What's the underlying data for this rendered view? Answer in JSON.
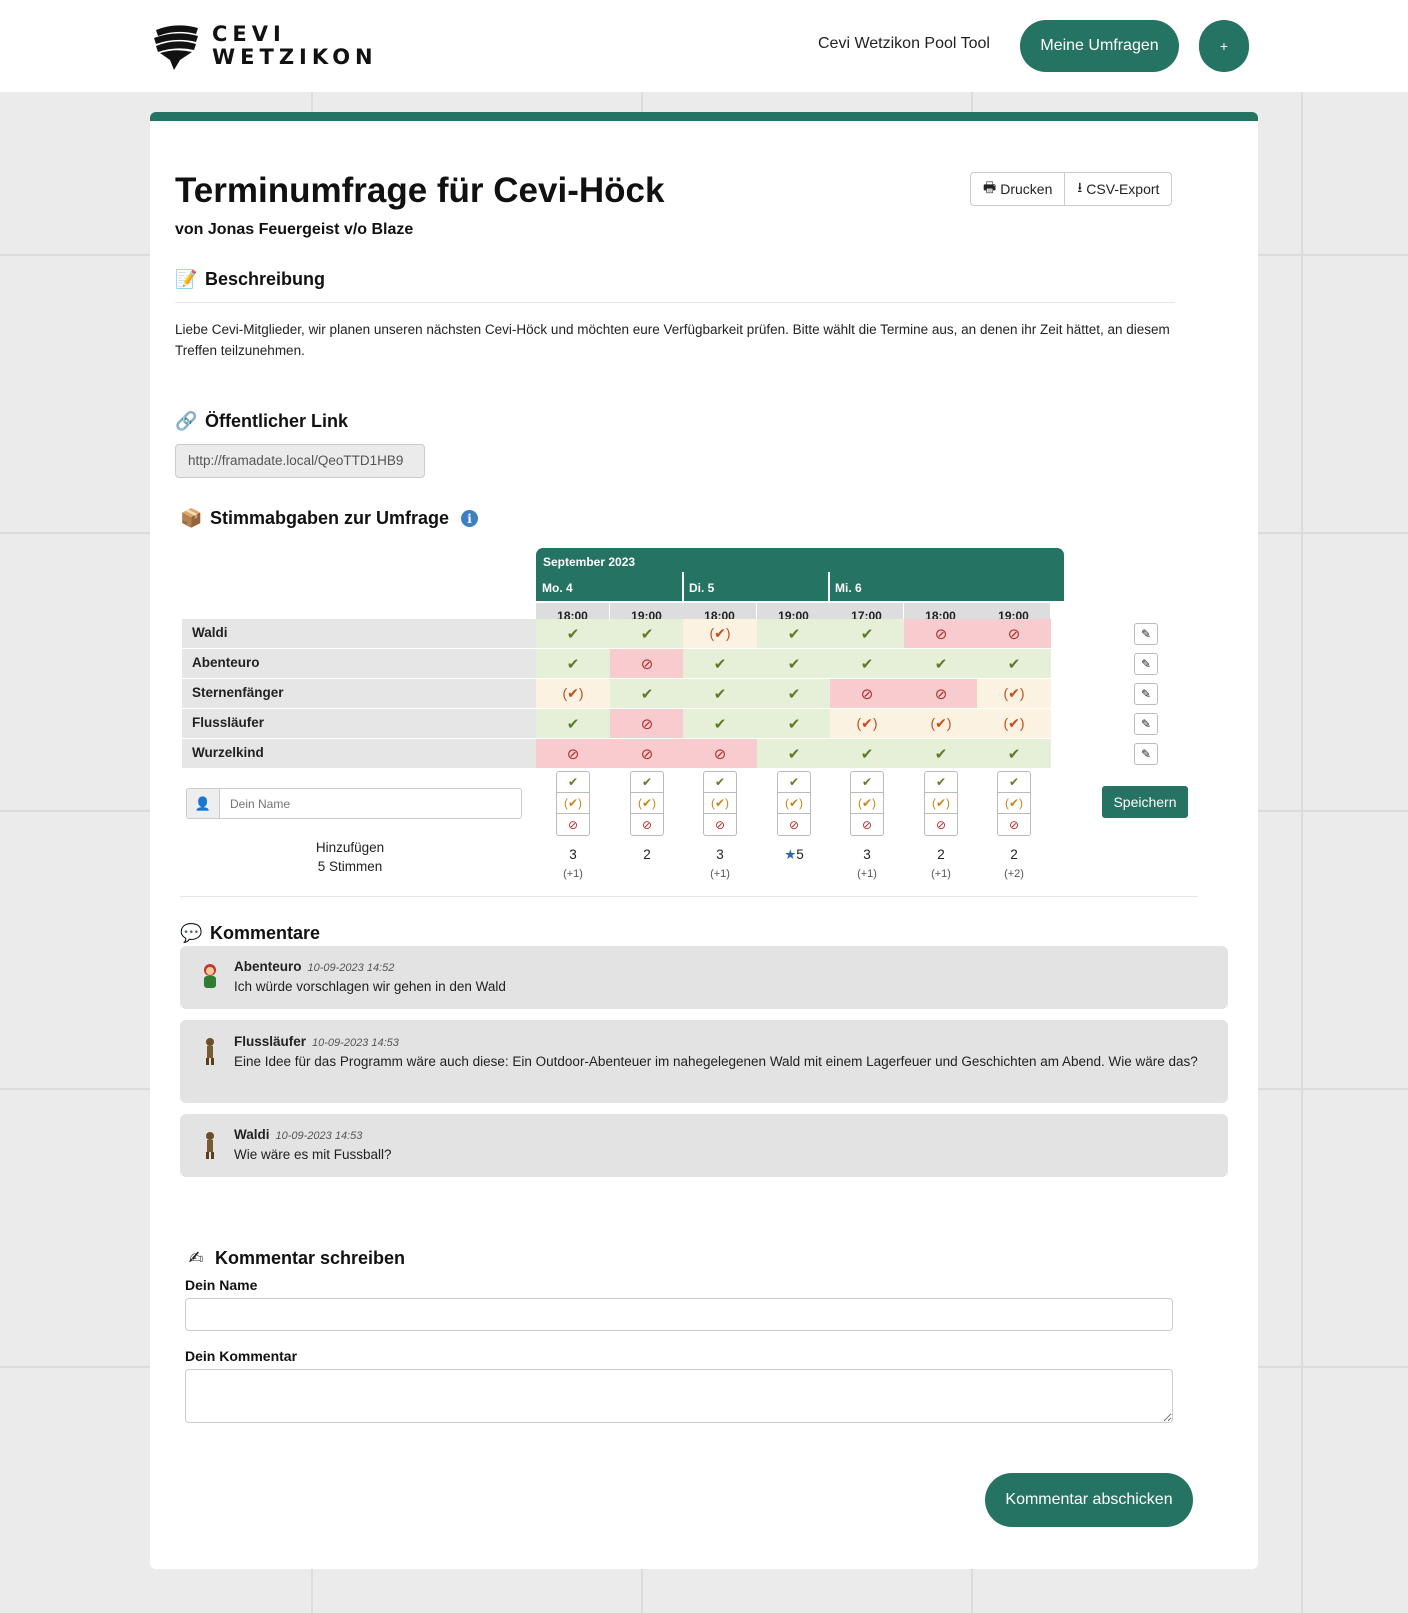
{
  "header": {
    "logo_line1": "CEVI",
    "logo_line2": "WETZIKON",
    "nav_title": "Cevi Wetzikon Pool Tool",
    "my_polls_label": "Meine Umfragen",
    "add_label": "+"
  },
  "poll": {
    "title": "Terminumfrage für Cevi-Höck",
    "author": "von Jonas Feuergeist v/o Blaze",
    "print_label": "Drucken",
    "csv_label": "CSV-Export",
    "description_heading": "Beschreibung",
    "description": "Liebe Cevi-Mitglieder, wir planen unseren nächsten Cevi-Höck und möchten eure Verfügbarkeit prüfen. Bitte wählt die Termine aus, an denen ihr Zeit hättet, an diesem Treffen teilzunehmen.",
    "public_link_heading": "Öffentlicher Link",
    "public_link": "http://framadate.local/QeoTTD1HB9",
    "votes_heading": "Stimmabgaben zur Umfrage"
  },
  "table": {
    "month": "September 2023",
    "days": [
      "Mo. 4",
      "Di. 5",
      "Mi. 6"
    ],
    "times": [
      "18:00",
      "19:00",
      "18:00",
      "19:00",
      "17:00",
      "18:00",
      "19:00"
    ],
    "rows": [
      {
        "name": "Waldi",
        "votes": [
          "yes",
          "yes",
          "ifneeded",
          "yes",
          "yes",
          "no",
          "no"
        ]
      },
      {
        "name": "Abenteuro",
        "votes": [
          "yes",
          "no",
          "yes",
          "yes",
          "yes",
          "yes",
          "yes"
        ]
      },
      {
        "name": "Sternenfänger",
        "votes": [
          "ifneeded",
          "yes",
          "yes",
          "yes",
          "no",
          "no",
          "ifneeded"
        ]
      },
      {
        "name": "Flussläufer",
        "votes": [
          "yes",
          "no",
          "yes",
          "yes",
          "ifneeded",
          "ifneeded",
          "ifneeded"
        ]
      },
      {
        "name": "Wurzelkind",
        "votes": [
          "no",
          "no",
          "no",
          "yes",
          "yes",
          "yes",
          "yes"
        ]
      }
    ],
    "name_placeholder": "Dein Name",
    "save_label": "Speichern",
    "add_label": "Hinzufügen",
    "votes_count_label": "5 Stimmen",
    "totals": [
      "3",
      "2",
      "3",
      "5",
      "3",
      "2",
      "2"
    ],
    "ifneeded_totals": [
      "(+1)",
      "",
      "(+1)",
      "",
      "(+1)",
      "(+1)",
      "(+2)"
    ],
    "best_column_index": 3
  },
  "comments": {
    "heading": "Kommentare",
    "items": [
      {
        "author": "Abenteuro",
        "date": "10-09-2023 14:52",
        "text": "Ich würde vorschlagen wir gehen in den Wald"
      },
      {
        "author": "Flussläufer",
        "date": "10-09-2023 14:53",
        "text": "Eine Idee für das Programm wäre auch diese: Ein Outdoor-Abenteuer im nahegelegenen Wald mit einem Lagerfeuer und Geschichten am Abend. Wie wäre das?"
      },
      {
        "author": "Waldi",
        "date": "10-09-2023 14:53",
        "text": "Wie wäre es mit Fussball?"
      }
    ]
  },
  "comment_form": {
    "heading": "Kommentar schreiben",
    "name_label": "Dein Name",
    "comment_label": "Dein Kommentar",
    "submit_label": "Kommentar abschicken"
  },
  "colors": {
    "accent": "#257363",
    "yes_bg": "#e6efd8",
    "ifneeded_bg": "#fcf2e2",
    "no_bg": "#f8ccce"
  }
}
